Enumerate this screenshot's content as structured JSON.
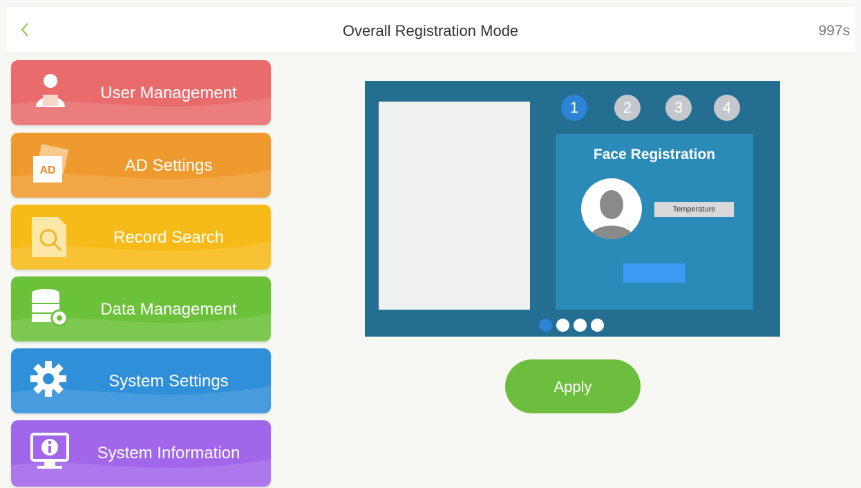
{
  "header": {
    "back_icon": "chevron-left-icon",
    "title": "Overall Registration Mode",
    "timer": "997s"
  },
  "menu": [
    {
      "label": "User Management",
      "icon": "user-icon",
      "color": "#ea6b6c"
    },
    {
      "label": "AD Settings",
      "icon": "ad-icon",
      "icon_text": "AD",
      "color": "#ef9a2f"
    },
    {
      "label": "Record Search",
      "icon": "search-document-icon",
      "color": "#f6bb18"
    },
    {
      "label": "Data Management",
      "icon": "database-gear-icon",
      "color": "#6cc13a"
    },
    {
      "label": "System Settings",
      "icon": "gear-icon",
      "color": "#2f8fd9"
    },
    {
      "label": "System Information",
      "icon": "info-monitor-icon",
      "color": "#a166ea"
    }
  ],
  "preview": {
    "steps": [
      "1",
      "2",
      "3",
      "4"
    ],
    "active_step": "1",
    "card_title": "Face Registration",
    "temperature_label": "Temperature",
    "page_dots": 4,
    "active_dot": 1
  },
  "apply_label": "Apply",
  "colors": {
    "accent_green": "#6dbe3e",
    "preview_bg": "#236e91",
    "card_bg": "#2a8bb9",
    "step_active": "#2e84d4"
  }
}
